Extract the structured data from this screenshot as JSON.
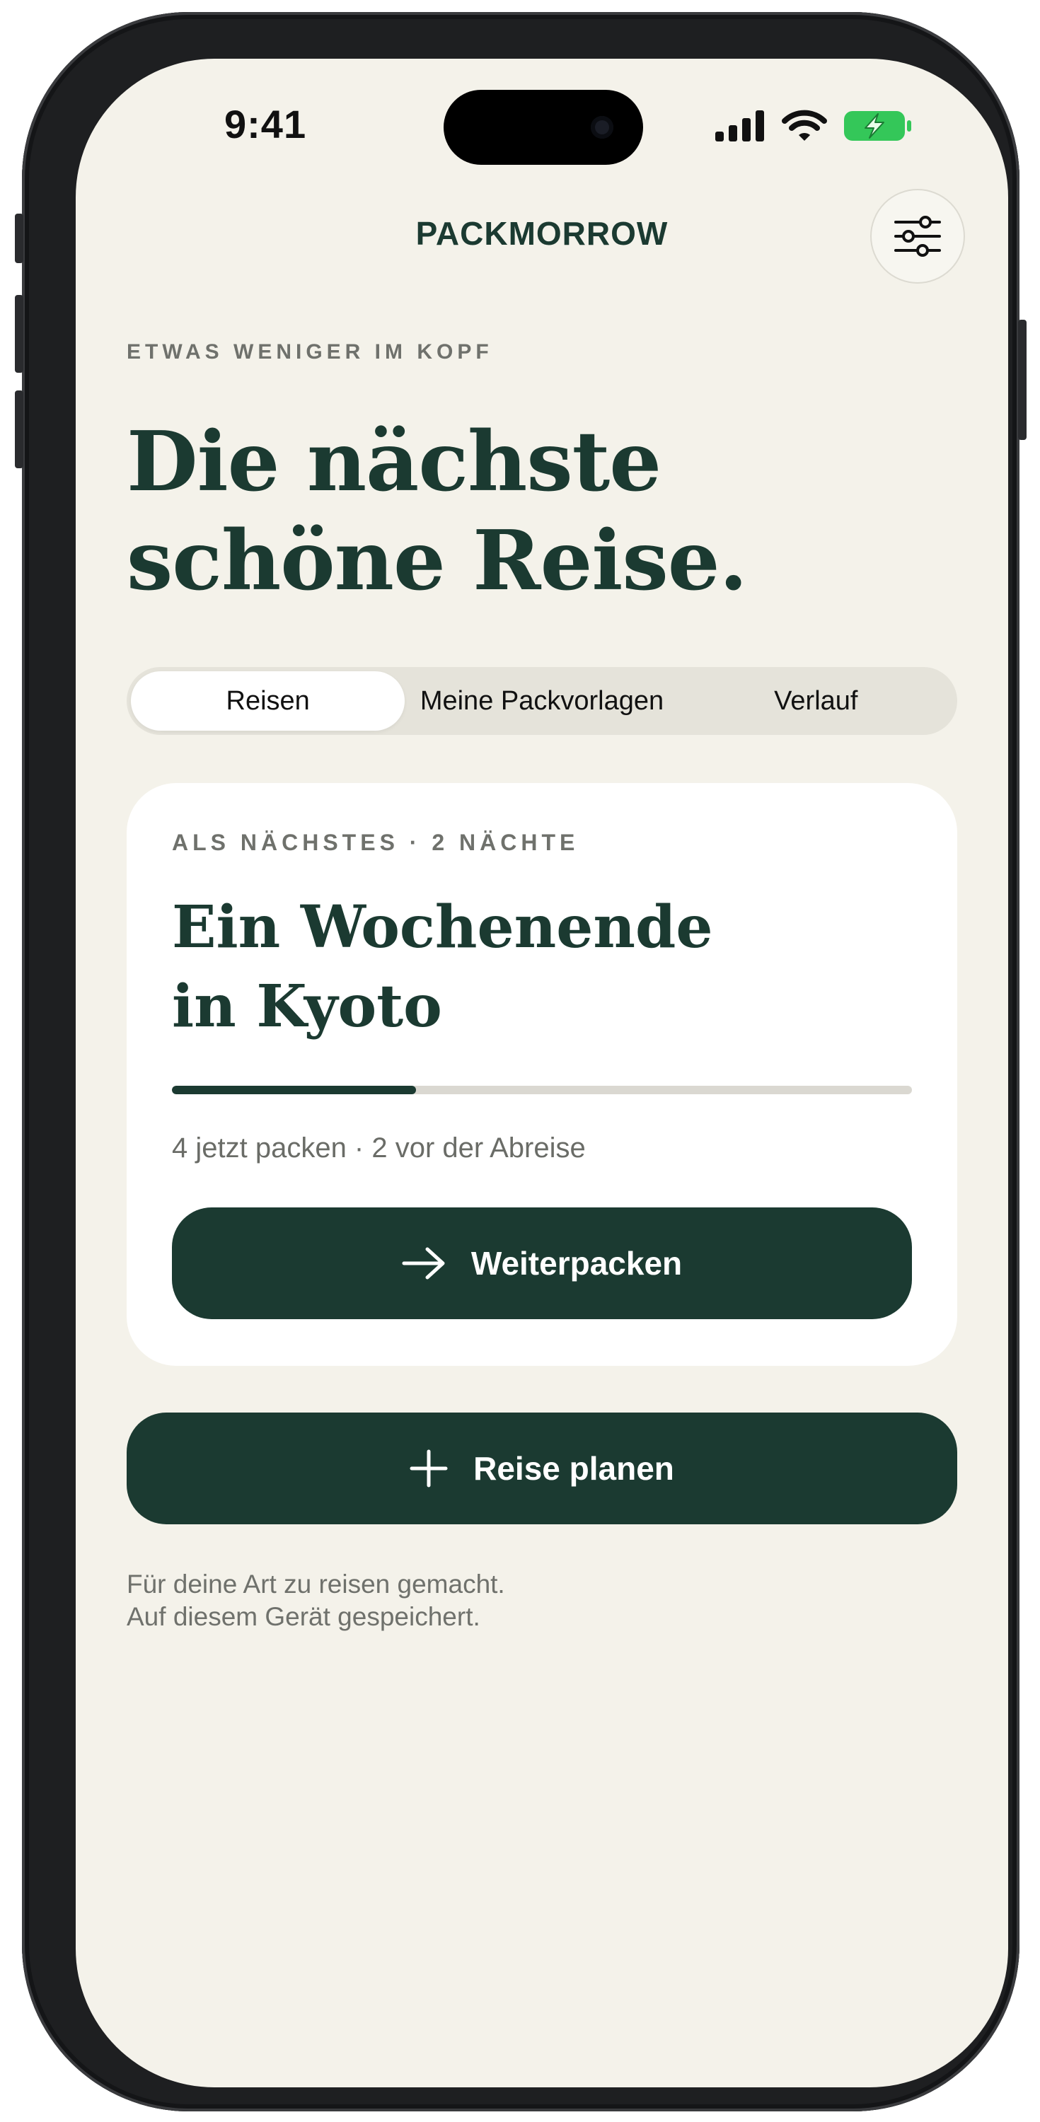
{
  "status_bar": {
    "time": "9:41",
    "signal_icon": "cellular-signal-icon",
    "wifi_icon": "wifi-icon",
    "battery_icon": "battery-charging-icon",
    "battery_color": "#34c759"
  },
  "header": {
    "title": "PACKMORROW",
    "settings_icon": "sliders-icon"
  },
  "hero": {
    "eyebrow": "ETWAS WENIGER IM KOPF",
    "headline_line1": "Die nächste",
    "headline_line2": "schöne Reise."
  },
  "tabs": [
    {
      "label": "Reisen",
      "active": true
    },
    {
      "label": "Meine Packvorlagen",
      "active": false
    },
    {
      "label": "Verlauf",
      "active": false
    }
  ],
  "trip_card": {
    "eyebrow": "ALS NÄCHSTES · 2 NÄCHTE",
    "title_line1": "Ein Wochenende",
    "title_line2": "in Kyoto",
    "progress": 0.33,
    "meta": "4 jetzt packen · 2 vor der Abreise",
    "button_label": "Weiterpacken",
    "button_icon": "arrow-right-icon"
  },
  "plan_button": {
    "label": "Reise planen",
    "icon": "plus-icon"
  },
  "footnote": {
    "line1": "Für deine Art zu reisen gemacht.",
    "line2": "Auf diesem Gerät gespeichert."
  },
  "colors": {
    "accent": "#1b3a31",
    "background": "#f4f2ea",
    "card": "#ffffff",
    "muted_text": "#6f716c"
  }
}
